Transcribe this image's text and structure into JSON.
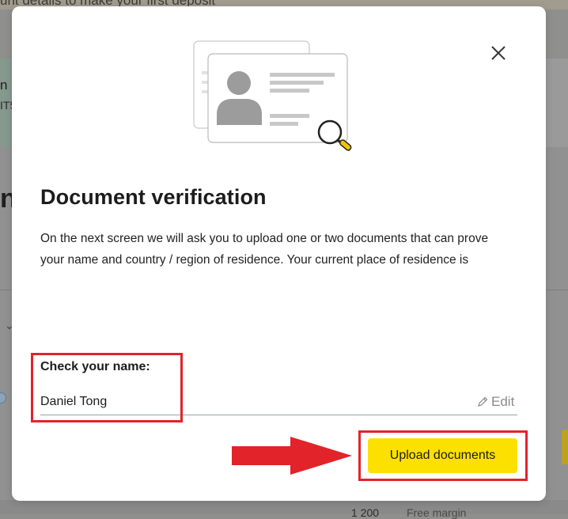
{
  "background": {
    "banner_text": "unt details to make your first deposit",
    "card_line1": "n C",
    "card_line2": "IT5",
    "heading_fragment": "nt",
    "amount": "1 200",
    "free_margin_label": "Free margin"
  },
  "modal": {
    "title": "Document verification",
    "description": "On the next screen we will ask you to upload one or two documents that can prove your name and country / region of residence. Your current place of residence is",
    "name_section": {
      "label": "Check your name:",
      "value": "Daniel Tong",
      "edit_label": "Edit"
    },
    "upload_button_label": "Upload documents",
    "icons": {
      "close": "close-icon",
      "edit": "pencil-icon",
      "illustration": "id-card-magnifier-illustration"
    }
  },
  "colors": {
    "accent_yellow": "#fce000",
    "annotation_red": "#e2232a",
    "overlay": "#8f8f8d"
  }
}
